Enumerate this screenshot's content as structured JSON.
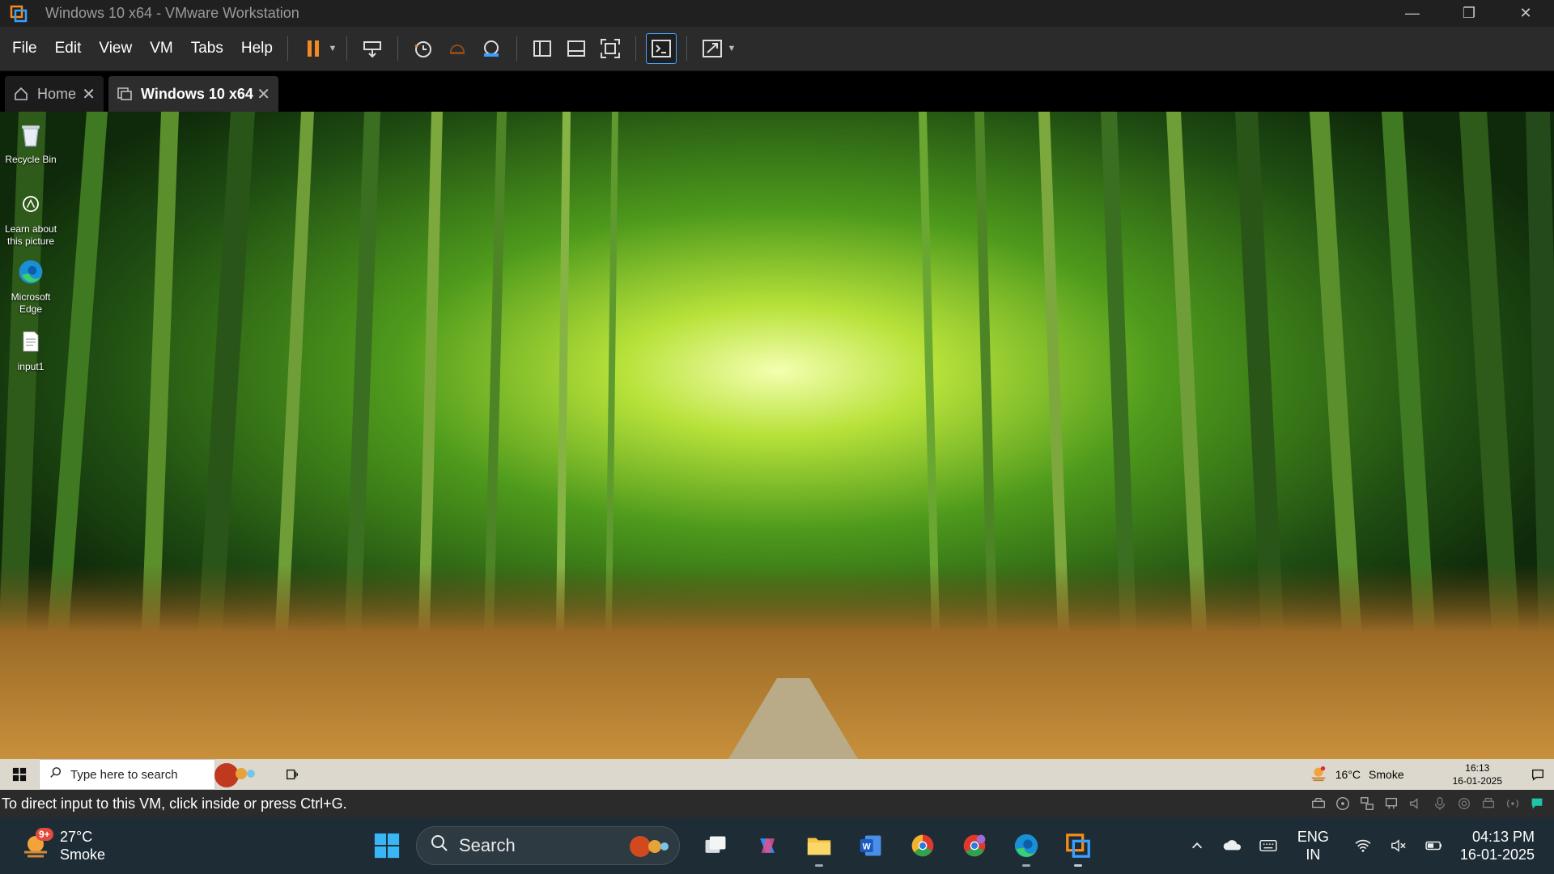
{
  "window": {
    "title": "Windows 10 x64 - VMware Workstation"
  },
  "menu": {
    "file": "File",
    "edit": "Edit",
    "view": "View",
    "vm": "VM",
    "tabs": "Tabs",
    "help": "Help"
  },
  "tabs": [
    {
      "label": "Home",
      "icon": "home-icon"
    },
    {
      "label": "Windows 10 x64",
      "icon": "vm-icon",
      "active": true
    }
  ],
  "desktop": {
    "icons": [
      {
        "label": "Recycle Bin",
        "icon": "recycle-bin-icon"
      },
      {
        "label": "Learn about this picture",
        "icon": "camera-icon"
      },
      {
        "label": "Microsoft Edge",
        "icon": "edge-icon"
      },
      {
        "label": "input1",
        "icon": "text-file-icon"
      }
    ]
  },
  "guest_taskbar": {
    "search_placeholder": "Type here to search",
    "weather_temp": "16°C",
    "weather_condition": "Smoke",
    "time": "16:13",
    "date": "16-01-2025"
  },
  "statusbar": {
    "text": "To direct input to this VM, click inside or press Ctrl+G."
  },
  "host_taskbar": {
    "weather_badge": "9+",
    "weather_temp": "27°C",
    "weather_condition": "Smoke",
    "search_label": "Search",
    "lang_top": "ENG",
    "lang_bottom": "IN",
    "time": "04:13 PM",
    "date": "16-01-2025"
  },
  "colors": {
    "accent": "#4aa3ff",
    "pause": "#f08a24",
    "guest_taskbar": "#ddd8ce",
    "host_taskbar": "#1e2c35"
  }
}
